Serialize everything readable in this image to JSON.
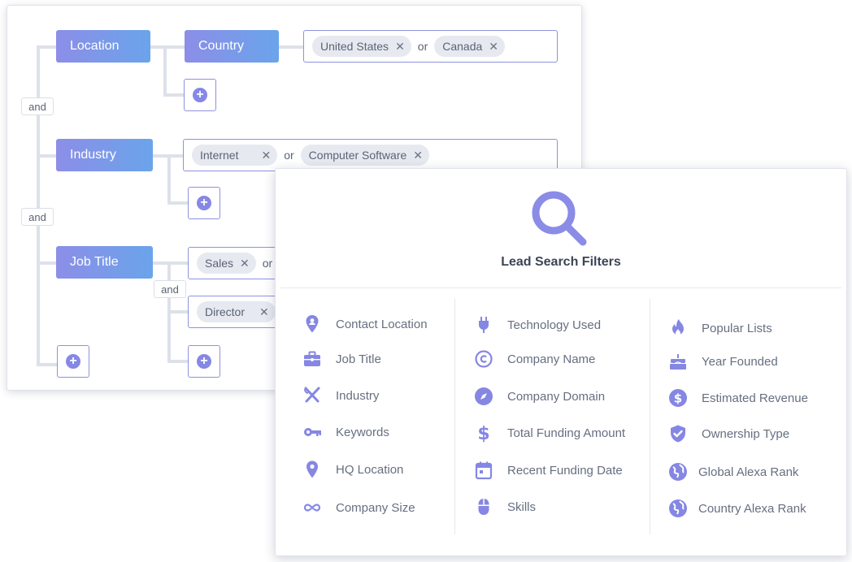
{
  "builder": {
    "connectors": [
      "and",
      "and"
    ],
    "rows": [
      {
        "field": "Location",
        "sub_field": "Country",
        "values": [
          "United States",
          "Canada"
        ],
        "joiner": "or"
      },
      {
        "field": "Industry",
        "values": [
          "Internet",
          "Computer Software"
        ],
        "joiner": "or"
      },
      {
        "field": "Job Title",
        "values_a": [
          "Sales"
        ],
        "joiner_a": "or",
        "inner_connector": "and",
        "values_b": [
          "Director"
        ]
      }
    ]
  },
  "filters": {
    "title": "Lead Search Filters",
    "columns": [
      [
        {
          "label": "Contact Location",
          "icon": "person-pin-icon"
        },
        {
          "label": "Job Title",
          "icon": "briefcase-icon"
        },
        {
          "label": "Industry",
          "icon": "utensils-icon"
        },
        {
          "label": "Keywords",
          "icon": "key-icon"
        },
        {
          "label": "HQ Location",
          "icon": "map-pin-icon"
        },
        {
          "label": "Company Size",
          "icon": "infinity-icon"
        }
      ],
      [
        {
          "label": "Technology Used",
          "icon": "plug-icon"
        },
        {
          "label": "Company Name",
          "icon": "copyright-icon"
        },
        {
          "label": "Company Domain",
          "icon": "compass-icon"
        },
        {
          "label": "Total Funding Amount",
          "icon": "dollar-icon"
        },
        {
          "label": "Recent Funding Date",
          "icon": "calendar-icon"
        },
        {
          "label": "Skills",
          "icon": "mouse-icon"
        }
      ],
      [
        {
          "label": "Popular Lists",
          "icon": "flame-icon"
        },
        {
          "label": "Year Founded",
          "icon": "cake-icon"
        },
        {
          "label": "Estimated Revenue",
          "icon": "dollar-circle-icon"
        },
        {
          "label": "Ownership Type",
          "icon": "shield-check-icon"
        },
        {
          "label": "Global Alexa Rank",
          "icon": "globe-icon"
        },
        {
          "label": "Country Alexa Rank",
          "icon": "globe-icon"
        }
      ]
    ]
  },
  "colors": {
    "accent": "#8688e6",
    "gradient_start": "#8c8ee8",
    "gradient_end": "#6aa4ea",
    "icon": "#8587e3"
  }
}
